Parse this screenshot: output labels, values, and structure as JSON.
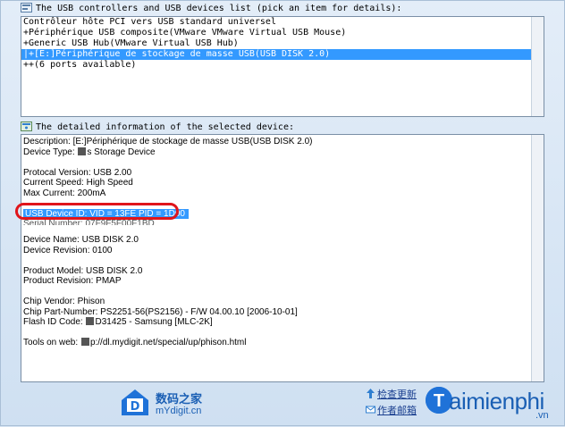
{
  "colors": {
    "selection": "#3399ff",
    "highlight_ring": "#e0151b",
    "brand": "#1a5fb4"
  },
  "devices_header": "The USB controllers and USB devices list (pick an item for details):",
  "devices": [
    {
      "label": "Contrôleur hôte PCI vers USB standard universel",
      "selected": false
    },
    {
      "label": "+Périphérique USB composite(VMware VMware Virtual USB Mouse)",
      "selected": false
    },
    {
      "label": "+Generic USB Hub(VMware Virtual USB Hub)",
      "selected": false
    },
    {
      "label": "|+[E:]Périphérique de stockage de masse USB(USB DISK 2.0)",
      "selected": true
    },
    {
      "label": "++(6 ports available)",
      "selected": false
    }
  ],
  "details_header": "The detailed information of the selected device:",
  "details": {
    "description": "Description: [E:]Périphérique de stockage de masse USB(USB DISK 2.0)",
    "device_type_prefix": "Device Type:",
    "device_type_value": "s Storage Device",
    "protocol_version": "Protocal Version: USB 2.00",
    "current_speed": "Current Speed: High Speed",
    "max_current": "Max Current: 200mA",
    "usb_device_id": "USB Device ID: VID = 13FE PID = 1D00",
    "serial_number_partial": "Serial Number: 07F9F5F00F1BD",
    "device_name": "Device Name: USB DISK 2.0",
    "device_revision": "Device Revision: 0100",
    "product_model": "Product Model: USB DISK 2.0",
    "product_revision": "Product Revision: PMAP",
    "chip_vendor": "Chip Vendor: Phison",
    "chip_part_number": "Chip Part-Number: PS2251-56(PS2156) - F/W 04.00.10 [2006-10-01]",
    "flash_id_prefix": "Flash ID Code:",
    "flash_id_value": "D31425 - Samsung [MLC-2K]",
    "tools_prefix": "Tools on web:",
    "tools_value": "p://dl.mydigit.net/special/up/phison.html"
  },
  "footer": {
    "logo_cn": "数码之家",
    "logo_url": "mYdigit.cn",
    "link_update": "检查更新",
    "link_mail": "作者邮箱",
    "brand_name": "aimienphi",
    "brand_suffix": ".vn"
  }
}
